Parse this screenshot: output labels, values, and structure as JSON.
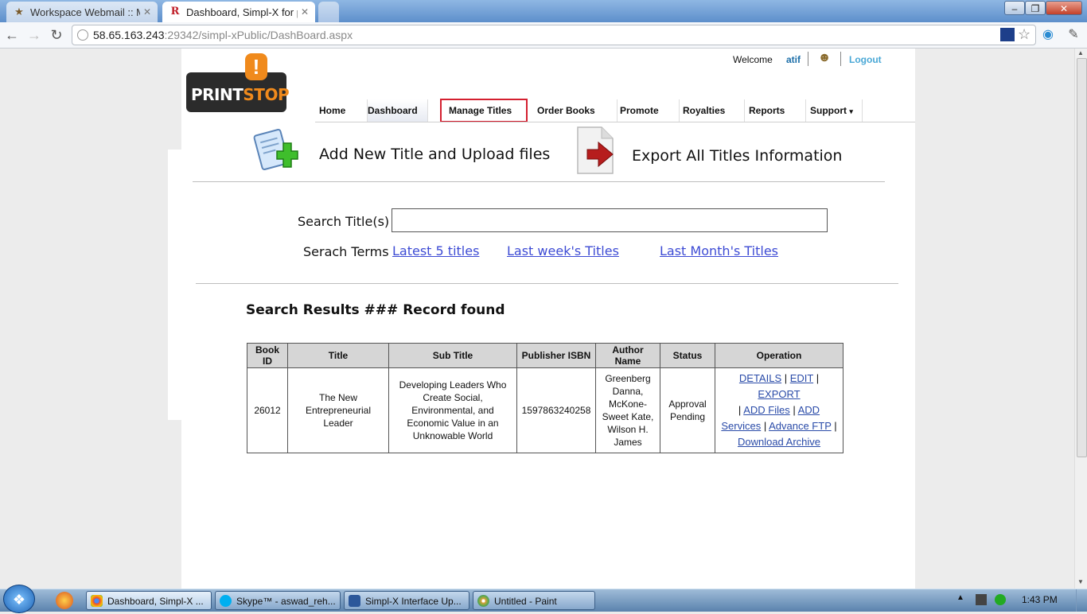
{
  "browser": {
    "tabs": [
      {
        "title": "Workspace Webmail :: Mail",
        "icon": "webmail-icon",
        "active": false
      },
      {
        "title": "Dashboard, Simpl-X for pub",
        "icon": "simplx-icon",
        "active": true
      }
    ],
    "url_host": "58.65.163.243",
    "url_rest": ":29342/simpl-xPublic/DashBoard.aspx"
  },
  "header": {
    "logo_text_a": "PRINT",
    "logo_text_b": "STOP",
    "logo_mark": "!",
    "welcome_label": "Welcome",
    "username": "atif",
    "logout_label": "Logout"
  },
  "menu": [
    {
      "label": "Home"
    },
    {
      "label": "Dashboard"
    },
    {
      "label": "Manage Titles"
    },
    {
      "label": "Order Books"
    },
    {
      "label": "Promote"
    },
    {
      "label": "Royalties"
    },
    {
      "label": "Reports"
    },
    {
      "label": "Support"
    }
  ],
  "actions": {
    "add_title_label": "Add New Title and Upload files",
    "export_label": "Export All Titles Information"
  },
  "search": {
    "label": "Search Title(s)",
    "value": "",
    "terms_label": "Serach Terms",
    "terms": [
      "Latest 5 titles",
      "Last week's Titles",
      "Last Month's Titles"
    ]
  },
  "results": {
    "heading": "Search Results ### Record found",
    "columns": [
      "Book ID",
      "Title",
      "Sub Title",
      "Publisher ISBN",
      "Author Name",
      "Status",
      "Operation"
    ],
    "rows": [
      {
        "book_id": "26012",
        "title": "The New Entrepreneurial Leader",
        "subtitle": "Developing Leaders Who Create Social, Environmental, and Economic Value in an Unknowable World",
        "isbn": "1597863240258",
        "author": "Greenberg Danna, McKone-Sweet Kate, Wilson H. James",
        "status": "Approval Pending",
        "operations": [
          "DETAILS",
          "EDIT",
          "EXPORT",
          "ADD Files",
          "ADD Services",
          "Advance FTP",
          "Download Archive"
        ]
      }
    ]
  },
  "taskbar": {
    "tasks": [
      "Dashboard, Simpl-X ...",
      "Skype™ - aswad_reh...",
      "Simpl-X Interface Up...",
      "Untitled - Paint"
    ],
    "clock": "1:43 PM"
  }
}
